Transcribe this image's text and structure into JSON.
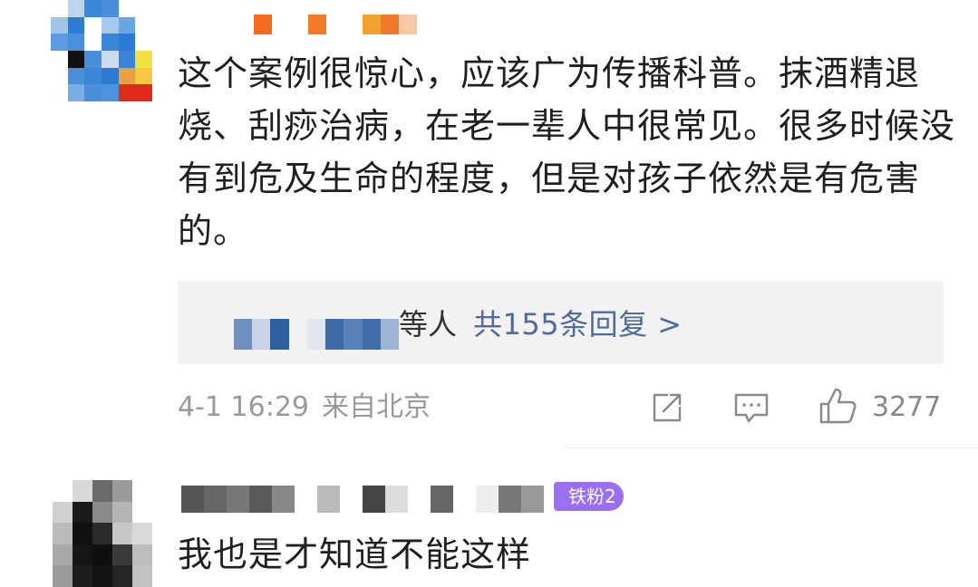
{
  "comment1": {
    "body": "这个案例很惊心，应该广为传播科普。抹酒精退烧、刮痧治病，在老一辈人中很常见。很多时候没有到危及生命的程度，但是对孩子依然是有危害的。",
    "replies": {
      "names_tail": "等人",
      "count_text": "共155条回复 >"
    },
    "date": "4-1 16:29",
    "location": "来自北京",
    "likes": "3277"
  },
  "comment2": {
    "fan_badge": "铁粉2",
    "body": "我也是才知道不能这样"
  },
  "colors": {
    "link": "#506a9b",
    "meta": "#9a9a9a",
    "badge": "#9b6ff2",
    "reply_bg": "#f2f2f2"
  },
  "icons": {
    "share": "share-icon",
    "comment": "comment-icon",
    "like": "thumbs-up-icon"
  }
}
